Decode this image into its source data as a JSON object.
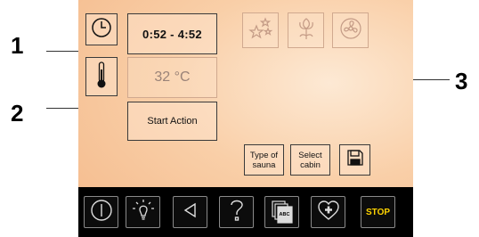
{
  "callouts": {
    "c1": "1",
    "c2": "2",
    "c3": "3"
  },
  "panel": {
    "time_range": "0:52 - 4:52",
    "temperature": "32 °C",
    "start_action": "Start Action",
    "type_of_sauna": "Type of sauna",
    "select_cabin": "Select cabin"
  },
  "bottom_bar": {
    "stop_label": "STOP",
    "abc_label": "ABC"
  },
  "icons": [
    "clock-icon",
    "thermometer-icon",
    "stars-icon",
    "flower-icon",
    "fan-icon",
    "save-icon",
    "power-icon",
    "light-bulb-icon",
    "back-arrow-icon",
    "help-icon",
    "pages-icon",
    "heart-plus-icon"
  ],
  "colors": {
    "background": "#f8c9a0",
    "bar": "#000000",
    "stop": "#ffd400"
  }
}
